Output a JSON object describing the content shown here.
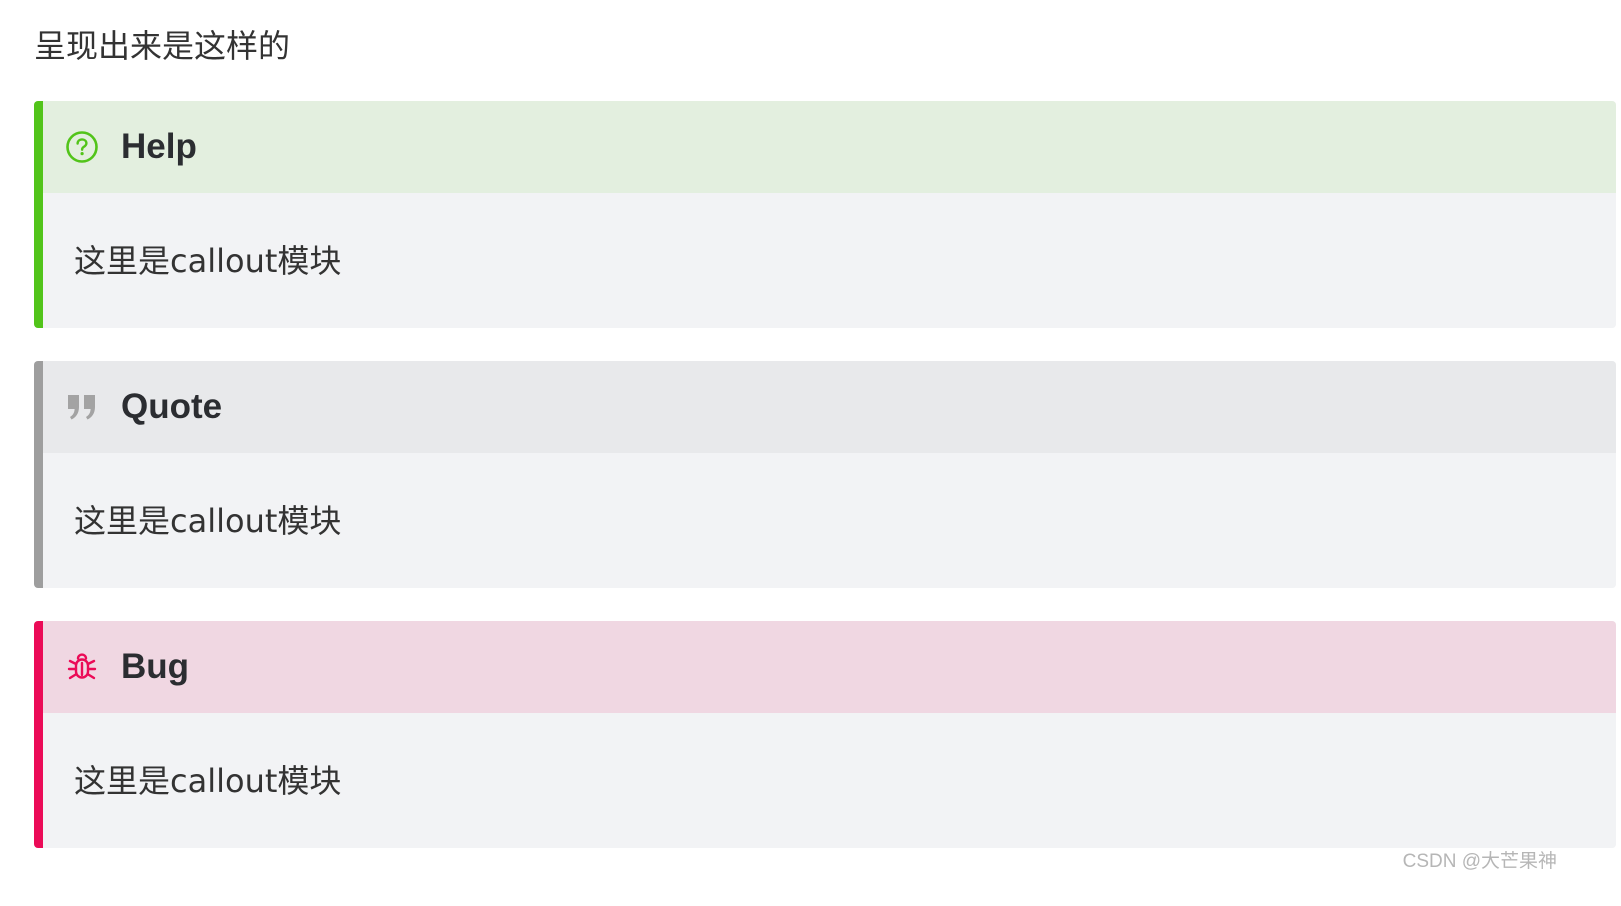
{
  "intro": "呈现出来是这样的",
  "callouts": [
    {
      "type": "help",
      "title": "Help",
      "icon": "question-circle-icon",
      "content": "这里是callout模块",
      "accent_color": "#52c41a",
      "header_bg": "#e3efdf"
    },
    {
      "type": "quote",
      "title": "Quote",
      "icon": "quote-icon",
      "content": "这里是callout模块",
      "accent_color": "#9e9e9e",
      "header_bg": "#e8e9eb"
    },
    {
      "type": "bug",
      "title": "Bug",
      "icon": "bug-icon",
      "content": "这里是callout模块",
      "accent_color": "#eb0b57",
      "header_bg": "#f0d7e2"
    }
  ],
  "watermark": "CSDN @大芒果神"
}
